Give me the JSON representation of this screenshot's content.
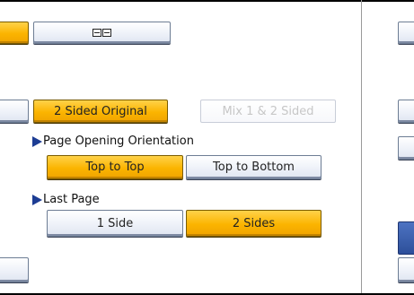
{
  "buttons": {
    "orientation_icon": "book-original-icon",
    "two_sided_original": "2 Sided Original",
    "mix_sided": "Mix 1 & 2 Sided"
  },
  "page_opening": {
    "heading": "Page Opening Orientation",
    "top_to_top": "Top to Top",
    "top_to_bottom": "Top to Bottom",
    "selected": "Top to Top"
  },
  "last_page": {
    "heading": "Last Page",
    "one_side": "1 Side",
    "two_sides": "2 Sides",
    "selected": "2 Sides"
  },
  "colors": {
    "selected": "#fbb400",
    "default": "#e8ecf5",
    "accent_blue": "#2d4f9a",
    "disabled_text": "#c7c7c7"
  }
}
